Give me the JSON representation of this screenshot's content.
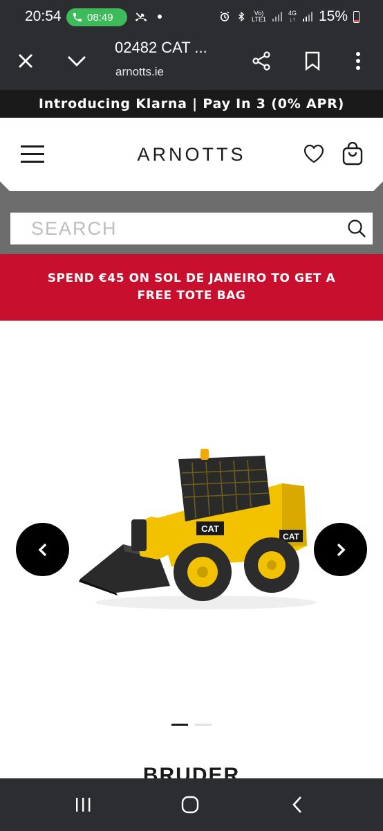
{
  "status_bar": {
    "time": "20:54",
    "call_timer": "08:49",
    "battery_percent": "15%",
    "network_vo": "Vo)",
    "network_lte": "LTE1",
    "network_4g": "4G"
  },
  "browser": {
    "page_title": "02482 CAT ...",
    "domain": "arnotts.ie"
  },
  "promo_banner": {
    "text": "Introducing Klarna | Pay In 3 (0% APR)"
  },
  "header": {
    "logo": "ARNOTTS"
  },
  "search": {
    "placeholder": "SEARCH",
    "value": ""
  },
  "offer_banner": {
    "line1": "SPEND €45 ON SOL DE JANEIRO TO GET A",
    "line2": "FREE TOTE BAG"
  },
  "gallery": {
    "current_slide": 1,
    "total_slides": 2
  },
  "product": {
    "brand": "BRUDER",
    "decal_text": "CAT"
  },
  "colors": {
    "system_bar": "#2b2d30",
    "promo_bg": "#1a1a1a",
    "search_band": "#6d6d6d",
    "offer_red": "#c8102e",
    "call_green": "#3fba5b",
    "cat_yellow": "#f2c200"
  },
  "icons": {
    "close": "close-icon",
    "dropdown": "chevron-down-icon",
    "share": "share-icon",
    "bookmark": "bookmark-icon",
    "more": "more-vertical-icon",
    "menu": "hamburger-icon",
    "wishlist": "heart-icon",
    "bag": "shopping-bag-icon",
    "search": "search-icon",
    "prev": "chevron-left-icon",
    "next": "chevron-right-icon"
  }
}
